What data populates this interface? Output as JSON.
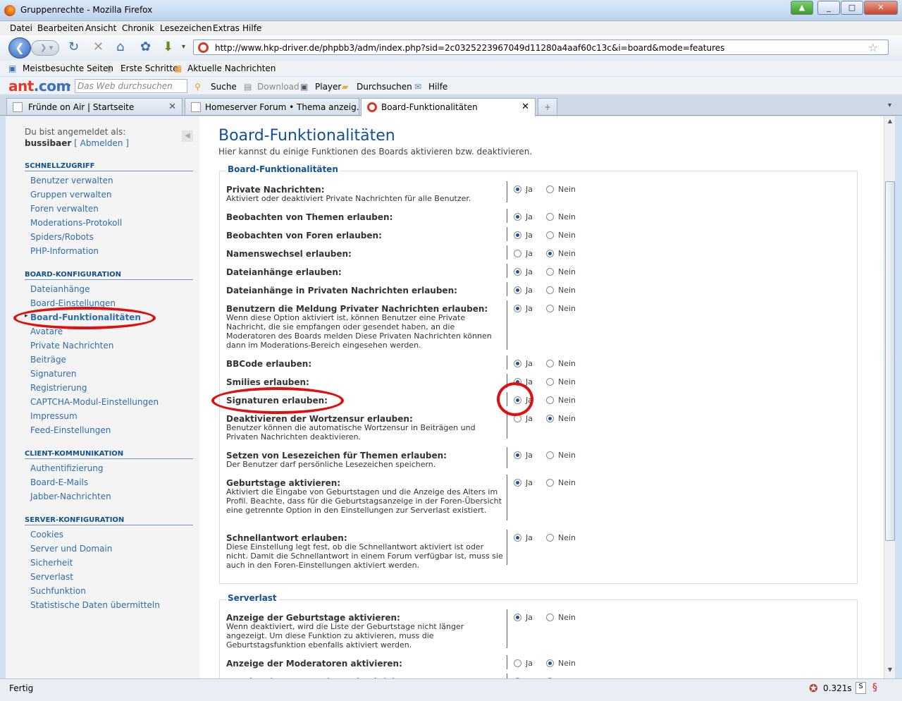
{
  "window": {
    "title": "Gruppenrechte - Mozilla Firefox"
  },
  "menu": [
    "Datei",
    "Bearbeiten",
    "Ansicht",
    "Chronik",
    "Lesezeichen",
    "Extras",
    "Hilfe"
  ],
  "url": "http://www.hkp-driver.de/phpbb3/adm/index.php?sid=2c0325223967049d11280a4aaf60c13c&i=board&mode=features",
  "bookmarks": [
    "Meistbesuchte Seiten",
    "Erste Schritte",
    "Aktuelle Nachrichten"
  ],
  "ant_toolbar": {
    "logo_left": "ant",
    "logo_right": ".com",
    "search_placeholder": "Das Web durchsuchen",
    "buttons": [
      "Suche",
      "Download",
      "Player",
      "Durchsuchen",
      "Hilfe"
    ]
  },
  "tabs": [
    {
      "label": "Fründe on Air | Startseite"
    },
    {
      "label": "Homeserver Forum • Thema anzeig..."
    },
    {
      "label": "Board-Funktionalitäten"
    }
  ],
  "sidebar": {
    "logged_in_as": "Du bist angemeldet als:",
    "username": "bussibaer",
    "logout": "[ Abmelden ]",
    "sections": [
      {
        "title": "SCHNELLZUGRIFF",
        "items": [
          "Benutzer verwalten",
          "Gruppen verwalten",
          "Foren verwalten",
          "Moderations-Protokoll",
          "Spiders/Robots",
          "PHP-Information"
        ]
      },
      {
        "title": "BOARD-KONFIGURATION",
        "items": [
          "Dateianhänge",
          "Board-Einstellungen",
          "Board-Funktionalitäten",
          "Avatare",
          "Private Nachrichten",
          "Beiträge",
          "Signaturen",
          "Registrierung",
          "CAPTCHA-Modul-Einstellungen",
          "Impressum",
          "Feed-Einstellungen"
        ]
      },
      {
        "title": "CLIENT-KOMMUNIKATION",
        "items": [
          "Authentifizierung",
          "Board-E-Mails",
          "Jabber-Nachrichten"
        ]
      },
      {
        "title": "SERVER-KONFIGURATION",
        "items": [
          "Cookies",
          "Server und Domain",
          "Sicherheit",
          "Serverlast",
          "Suchfunktion",
          "Statistische Daten übermitteln"
        ]
      }
    ]
  },
  "main": {
    "title": "Board-Funktionalitäten",
    "intro": "Hier kannst du einige Funktionen des Boards aktivieren bzw. deaktivieren.",
    "yes": "Ja",
    "no": "Nein",
    "fieldset1": {
      "legend": "Board-Funktionalitäten",
      "rows": [
        {
          "label": "Private Nachrichten:",
          "desc": "Aktiviert oder deaktiviert Private Nachrichten für alle Benutzer.",
          "value": "Ja"
        },
        {
          "label": "Beobachten von Themen erlauben:",
          "desc": "",
          "value": "Ja"
        },
        {
          "label": "Beobachten von Foren erlauben:",
          "desc": "",
          "value": "Ja"
        },
        {
          "label": "Namenswechsel erlauben:",
          "desc": "",
          "value": "Nein"
        },
        {
          "label": "Dateianhänge erlauben:",
          "desc": "",
          "value": "Ja"
        },
        {
          "label": "Dateianhänge in Privaten Nachrichten erlauben:",
          "desc": "",
          "value": "Ja"
        },
        {
          "label": "Benutzern die Meldung Privater Nachrichten erlauben:",
          "desc": "Wenn diese Option aktiviert ist, können Benutzer eine Private Nachricht, die sie empfangen oder gesendet haben, an die Moderatoren des Boards melden Diese Privaten Nachrichten können dann im Moderations-Bereich eingesehen werden.",
          "value": "Ja"
        },
        {
          "label": "BBCode erlauben:",
          "desc": "",
          "value": "Ja"
        },
        {
          "label": "Smilies erlauben:",
          "desc": "",
          "value": "Ja"
        },
        {
          "label": "Signaturen erlauben:",
          "desc": "",
          "value": "Ja"
        },
        {
          "label": "Deaktivieren der Wortzensur erlauben:",
          "desc": "Benutzer können die automatische Wortzensur in Beiträgen und Privaten Nachrichten deaktivieren.",
          "value": "Nein"
        },
        {
          "label": "Setzen von Lesezeichen für Themen erlauben:",
          "desc": "Der Benutzer darf persönliche Lesezeichen speichern.",
          "value": "Ja"
        },
        {
          "label": "Geburtstage aktivieren:",
          "desc": "Aktiviert die Eingabe von Geburtstagen und die Anzeige des Alters im Profil. Beachte, dass für die Geburtstagsanzeige in der Foren-Übersicht eine getrennte Option in den Einstellungen zur Serverlast existiert.",
          "value": "Ja"
        },
        {
          "label": "Schnellantwort erlauben:",
          "desc": "Diese Einstellung legt fest, ob die Schnellantwort aktiviert ist oder nicht. Damit die Schnellantwort in einem Forum verfügbar ist, muss sie auch in den Foren-Einstellungen aktiviert werden.",
          "value": "Ja"
        }
      ]
    },
    "fieldset2": {
      "legend": "Serverlast",
      "rows": [
        {
          "label": "Anzeige der Geburtstage aktivieren:",
          "desc": "Wenn deaktiviert, wird die Liste der Geburtstage nicht länger angezeigt. Um diese Funktion zu aktivieren, muss die Geburtstagsfunktion ebenfalls aktiviert werden.",
          "value": "Ja"
        },
        {
          "label": "Anzeige der Moderatoren aktivieren:",
          "desc": "",
          "value": "Nein"
        },
        {
          "label": "Anzeige der Gruppenlegende aktivieren:",
          "desc": "",
          "value": "Ja"
        }
      ]
    }
  },
  "status": {
    "text": "Fertig",
    "time": "0.321s"
  },
  "colors": {
    "link": "#2f6ca8",
    "heading": "#115098",
    "annotation": "#e01010"
  }
}
